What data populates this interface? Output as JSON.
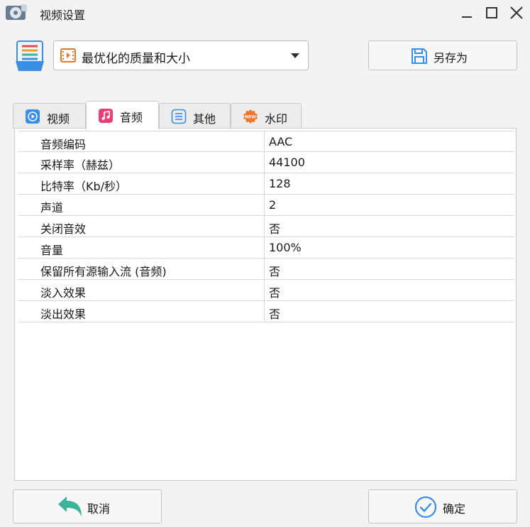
{
  "window": {
    "title": "视频设置"
  },
  "preset": {
    "value": "最优化的质量和大小"
  },
  "toolbar": {
    "save_as_label": "另存为"
  },
  "tabs": [
    {
      "label": "视频",
      "icon": "play-icon",
      "color": "#3a8ee6",
      "active": false
    },
    {
      "label": "音频",
      "icon": "music-note-icon",
      "color": "#ec3f76",
      "active": true
    },
    {
      "label": "其他",
      "icon": "list-icon",
      "color": "#3a8ee6",
      "active": false
    },
    {
      "label": "水印",
      "icon": "new-badge-icon",
      "color": "#f0722b",
      "active": false
    }
  ],
  "audio_settings": [
    {
      "key": "音频编码",
      "value": "AAC"
    },
    {
      "key": "采样率（赫兹）",
      "value": "44100"
    },
    {
      "key": "比特率（Kb/秒）",
      "value": "128"
    },
    {
      "key": "声道",
      "value": "2"
    },
    {
      "key": "关闭音效",
      "value": "否"
    },
    {
      "key": "音量",
      "value": "100%"
    },
    {
      "key": "保留所有源输入流 (音频)",
      "value": "否"
    },
    {
      "key": "淡入效果",
      "value": "否"
    },
    {
      "key": "淡出效果",
      "value": "否"
    }
  ],
  "footer": {
    "cancel_label": "取消",
    "ok_label": "确定"
  },
  "colors": {
    "accent_blue": "#3a8ee6",
    "cancel_green": "#3cb39a",
    "new_orange": "#f0722b"
  }
}
